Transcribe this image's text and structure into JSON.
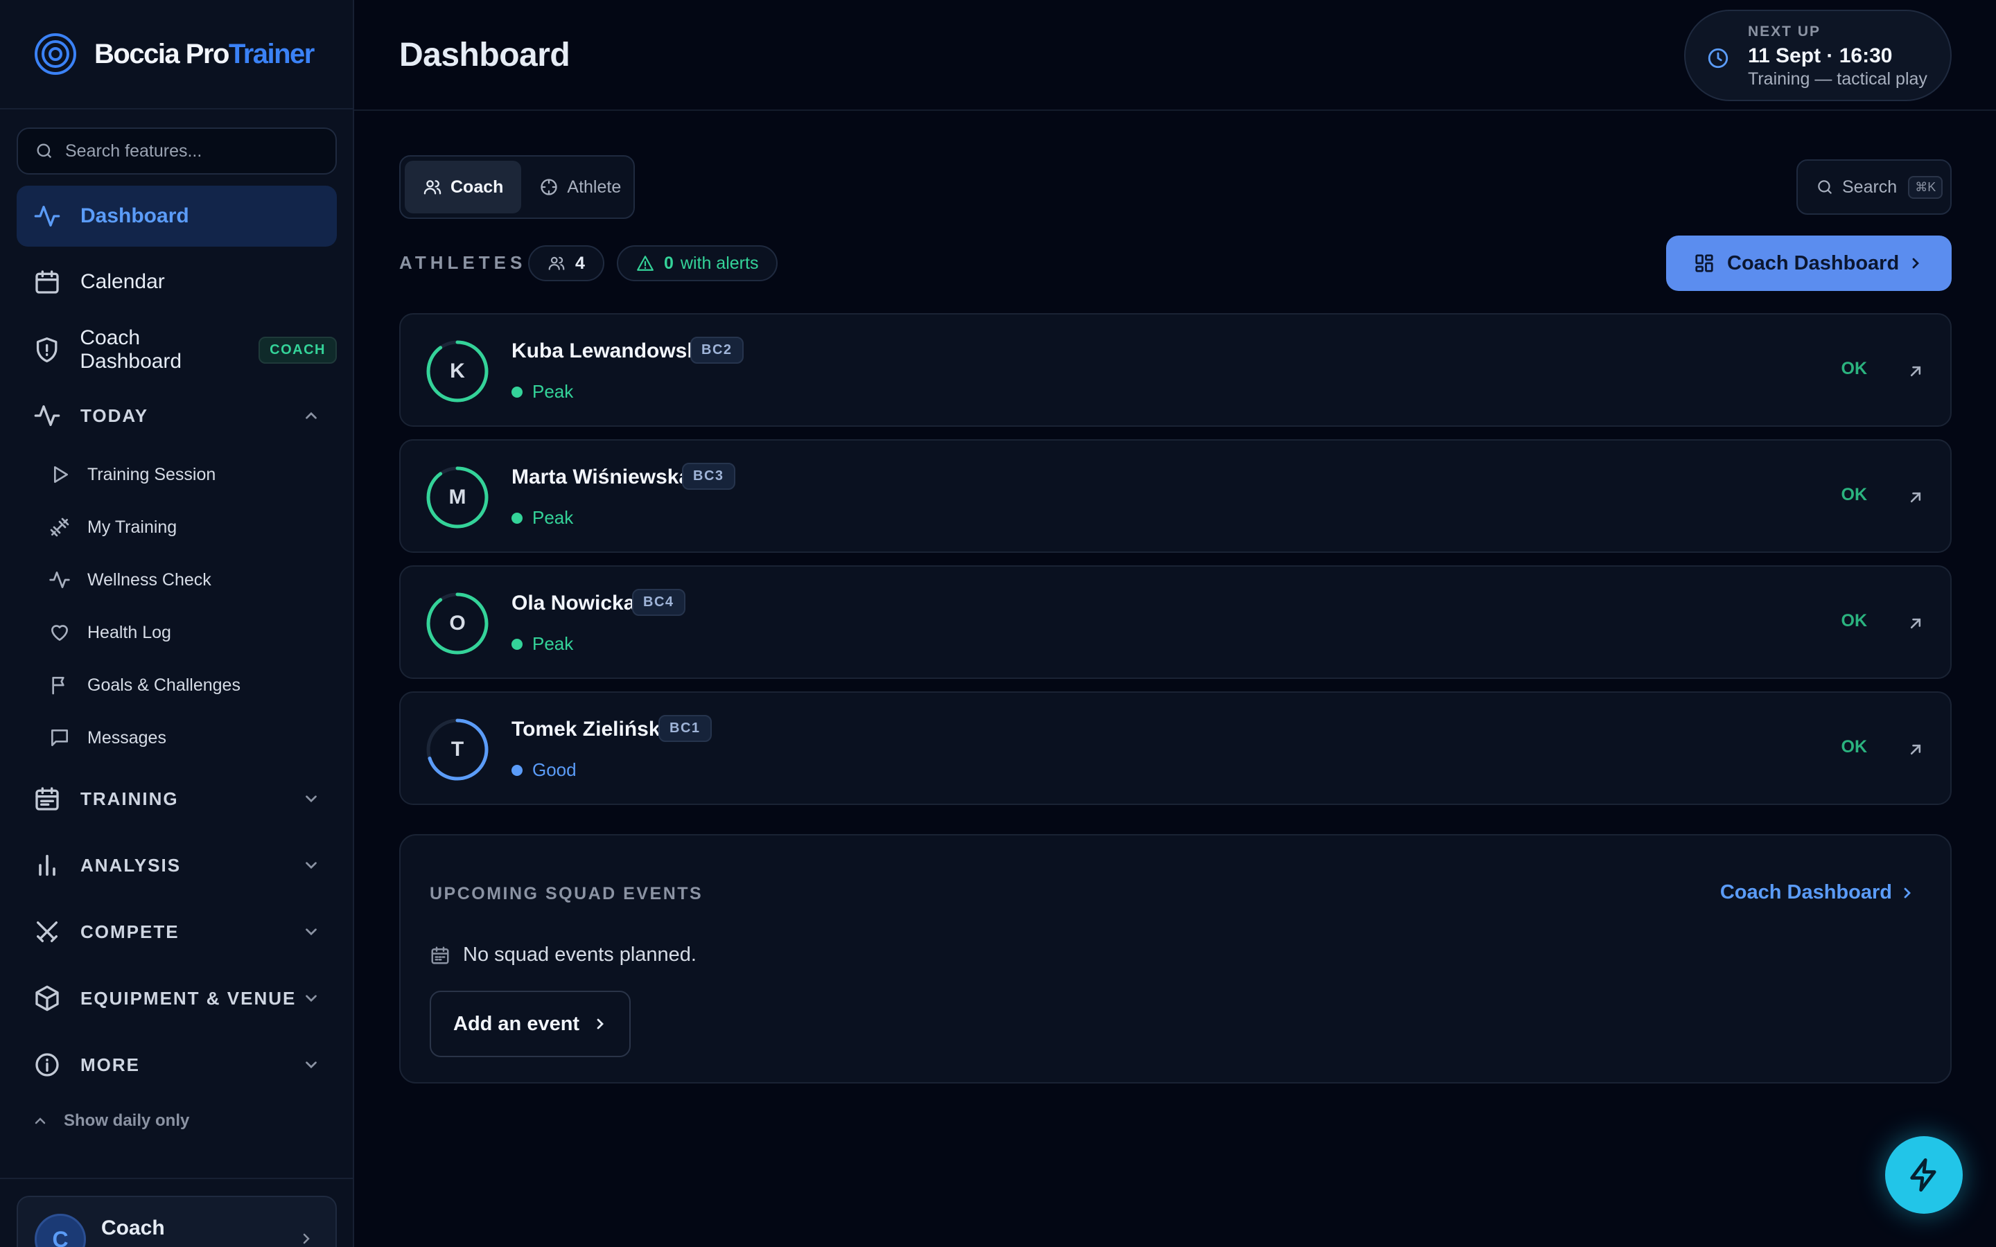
{
  "brand": {
    "name_primary": "Boccia Pro",
    "name_accent": "Trainer"
  },
  "sidebar": {
    "search_placeholder": "Search features...",
    "nav": [
      {
        "label": "Dashboard",
        "icon": "activity-icon",
        "active": true
      },
      {
        "label": "Calendar",
        "icon": "calendar-icon"
      },
      {
        "label": "Coach Dashboard",
        "icon": "shield-icon",
        "badge": "COACH"
      }
    ],
    "sections": [
      {
        "label": "TODAY",
        "icon": "activity-icon",
        "expanded": true,
        "items": [
          {
            "label": "Training Session",
            "icon": "play-icon"
          },
          {
            "label": "My Training",
            "icon": "dumbbell-icon"
          },
          {
            "label": "Wellness Check",
            "icon": "pulse-icon"
          },
          {
            "label": "Health Log",
            "icon": "heart-icon"
          },
          {
            "label": "Goals & Challenges",
            "icon": "flag-icon"
          },
          {
            "label": "Messages",
            "icon": "message-icon"
          }
        ]
      },
      {
        "label": "TRAINING",
        "icon": "calendar-list-icon"
      },
      {
        "label": "ANALYSIS",
        "icon": "bar-chart-icon"
      },
      {
        "label": "COMPETE",
        "icon": "swords-icon"
      },
      {
        "label": "EQUIPMENT & VENUE",
        "icon": "box-icon"
      },
      {
        "label": "MORE",
        "icon": "info-icon"
      }
    ],
    "show_daily_label": "Show daily only",
    "user": {
      "initial": "C",
      "name": "Coach"
    }
  },
  "header": {
    "title": "Dashboard",
    "next_up": {
      "label": "NEXT UP",
      "time": "11 Sept · 16:30",
      "description": "Training — tactical play"
    }
  },
  "view_toggle": {
    "options": [
      "Coach",
      "Athlete"
    ],
    "selected": "Coach"
  },
  "search_button": {
    "label": "Search",
    "shortcut": "⌘K"
  },
  "athletes": {
    "label": "ATHLETES",
    "count": "4",
    "alerts_count": "0",
    "alerts_label": "with alerts",
    "cta_label": "Coach Dashboard",
    "list": [
      {
        "initial": "K",
        "name": "Kuba Lewandowski",
        "class": "BC2",
        "status": "Peak",
        "status_color": "#34d399",
        "level": 0.9,
        "ok": "OK"
      },
      {
        "initial": "M",
        "name": "Marta Wiśniewska",
        "class": "BC3",
        "status": "Peak",
        "status_color": "#34d399",
        "level": 0.9,
        "ok": "OK"
      },
      {
        "initial": "O",
        "name": "Ola Nowicka",
        "class": "BC4",
        "status": "Peak",
        "status_color": "#34d399",
        "level": 0.9,
        "ok": "OK"
      },
      {
        "initial": "T",
        "name": "Tomek Zieliński",
        "class": "BC1",
        "status": "Good",
        "status_color": "#5b9cf8",
        "level": 0.7,
        "ok": "OK"
      }
    ]
  },
  "events": {
    "title": "UPCOMING SQUAD EVENTS",
    "link_label": "Coach Dashboard",
    "empty_text": "No squad events planned.",
    "add_label": "Add an event"
  },
  "colors": {
    "accent": "#5b8def",
    "success": "#34d399",
    "good": "#5b9cf8",
    "fab": "#22c5e8"
  }
}
